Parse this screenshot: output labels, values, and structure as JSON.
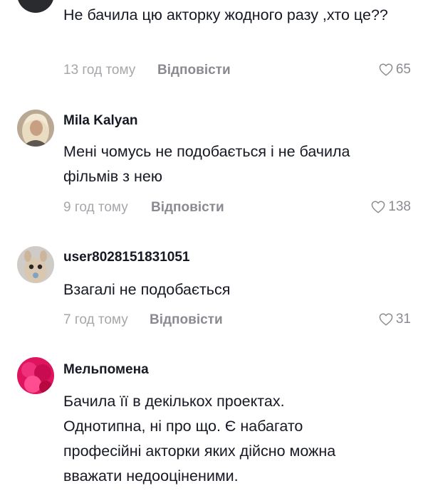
{
  "comments": [
    {
      "username": "",
      "text": "Не бачила цю акторку жодного разу ,хто це??",
      "time": "13 год тому",
      "reply_label": "Відповісти",
      "likes": "65",
      "avatar_icon": "user-avatar-icon"
    },
    {
      "username": "Mila Kalyan",
      "text": "Мені чомусь не подобається і не бачила фільмів з нею",
      "time": "9 год тому",
      "reply_label": "Відповісти",
      "likes": "138",
      "avatar_icon": "user-avatar-icon"
    },
    {
      "username": "user8028151831051",
      "text": "Взагалі не подобається",
      "time": "7 год тому",
      "reply_label": "Відповісти",
      "likes": "31",
      "avatar_icon": "user-avatar-icon"
    },
    {
      "username": "Мельпомена",
      "text": "Бачила її в декількох проектах. Однотипна, ні про що. Є набагато професійні акторки яких дійсно можна вважати недооціненими.",
      "avatar_icon": "user-avatar-icon"
    }
  ],
  "colors": {
    "text": "#161823",
    "muted": "#a6a7ab",
    "action": "#8a8b91"
  }
}
